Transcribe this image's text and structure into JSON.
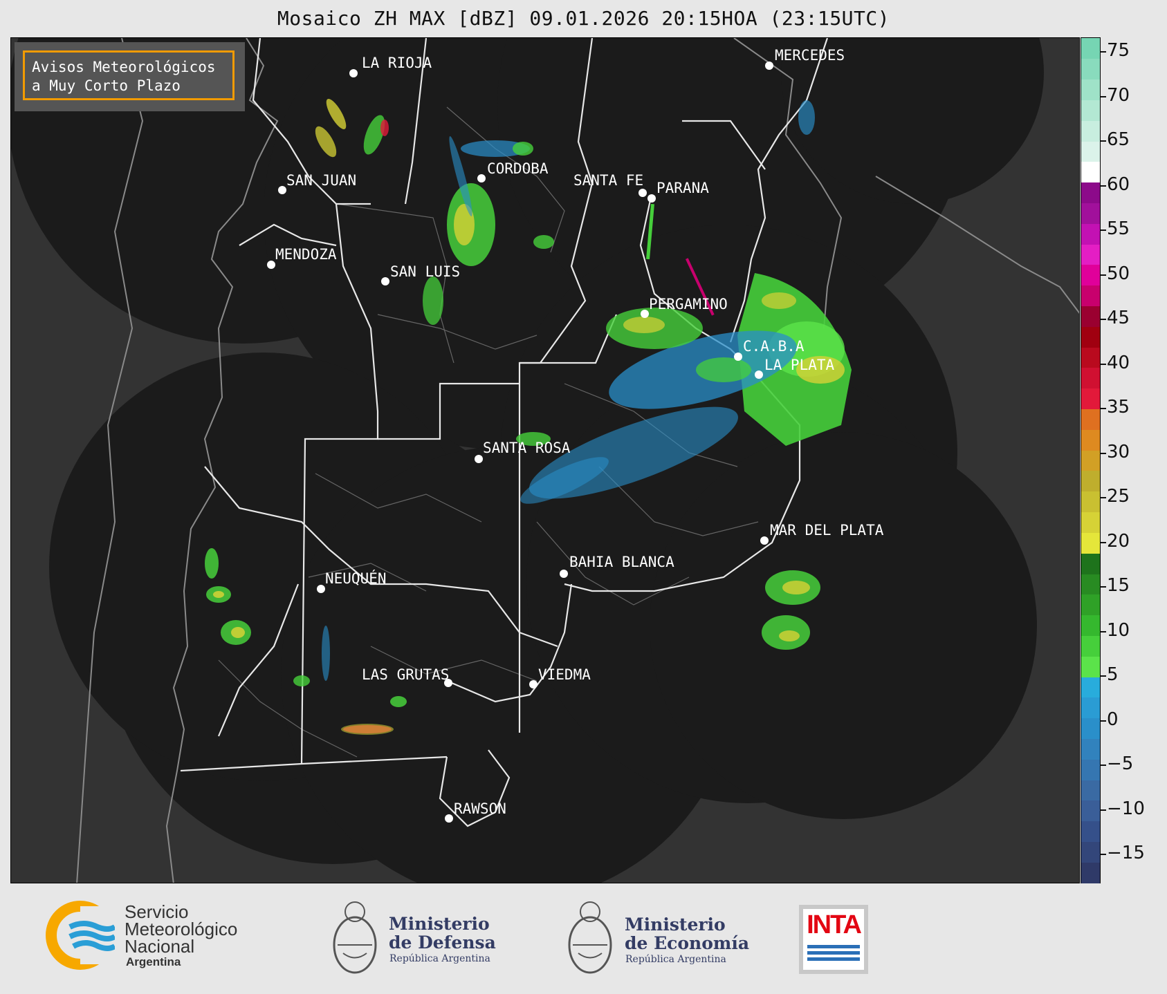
{
  "title": "Mosaico ZH MAX [dBZ] 09.01.2026 20:15HOA (23:15UTC)",
  "warning_box": {
    "line1": "Avisos Meteorológicos",
    "line2": "a Muy Corto Plazo",
    "border_color": "#f29b00"
  },
  "cities": [
    {
      "name": "LA RIOJA",
      "id": "la-rioja"
    },
    {
      "name": "SAN JUAN",
      "id": "san-juan"
    },
    {
      "name": "CORDOBA",
      "id": "cordoba"
    },
    {
      "name": "SANTA FE",
      "id": "santa-fe"
    },
    {
      "name": "PARANA",
      "id": "parana"
    },
    {
      "name": "MERCEDES",
      "id": "mercedes"
    },
    {
      "name": "MENDOZA",
      "id": "mendoza"
    },
    {
      "name": "SAN LUIS",
      "id": "san-luis"
    },
    {
      "name": "PERGAMINO",
      "id": "pergamino"
    },
    {
      "name": "C.A.B.A",
      "id": "caba"
    },
    {
      "name": "LA PLATA",
      "id": "la-plata"
    },
    {
      "name": "SANTA ROSA",
      "id": "santa-rosa"
    },
    {
      "name": "MAR DEL PLATA",
      "id": "mar-del-plata"
    },
    {
      "name": "BAHIA BLANCA",
      "id": "bahia-blanca"
    },
    {
      "name": "NEUQUÉN",
      "id": "neuquen"
    },
    {
      "name": "LAS GRUTAS",
      "id": "las-grutas"
    },
    {
      "name": "VIEDMA",
      "id": "viedma"
    },
    {
      "name": "RAWSON",
      "id": "rawson"
    }
  ],
  "colorbar": {
    "ticks": [
      "75",
      "70",
      "65",
      "60",
      "55",
      "50",
      "45",
      "40",
      "35",
      "30",
      "25",
      "20",
      "15",
      "10",
      "5",
      "0",
      "−5",
      "−10",
      "−15"
    ],
    "colors_low_to_high": [
      "#2f3a68",
      "#33467a",
      "#35508a",
      "#3a5e98",
      "#3a6aa3",
      "#3576b1",
      "#3182bd",
      "#2a8fca",
      "#2a9cd4",
      "#28acdc",
      "#5be34a",
      "#46cf3b",
      "#35b82e",
      "#2fa127",
      "#288b22",
      "#1e731c",
      "#e5e63a",
      "#d6d236",
      "#c9c031",
      "#bfae2d",
      "#d2a025",
      "#de8a20",
      "#df7020",
      "#e2193a",
      "#d01031",
      "#b90a1e",
      "#a00010",
      "#9a0030",
      "#c8006d",
      "#e0009a",
      "#e41ec4",
      "#c311b3",
      "#a1109b",
      "#8c0a8a",
      "#ffffff",
      "#dbf3ea",
      "#c8eedf",
      "#b3e8d3",
      "#9fe2c8",
      "#89dbbd",
      "#76d5b3"
    ]
  },
  "footer": {
    "smn_line1": "Servicio",
    "smn_line2": "Meteorológico",
    "smn_line3": "Nacional",
    "smn_line4": "Argentina",
    "defensa_line1": "Ministerio",
    "defensa_line2": "de Defensa",
    "defensa_line3": "República Argentina",
    "economia_line1": "Ministerio",
    "economia_line2": "de Economía",
    "economia_line3": "República Argentina",
    "inta": "INTA"
  }
}
